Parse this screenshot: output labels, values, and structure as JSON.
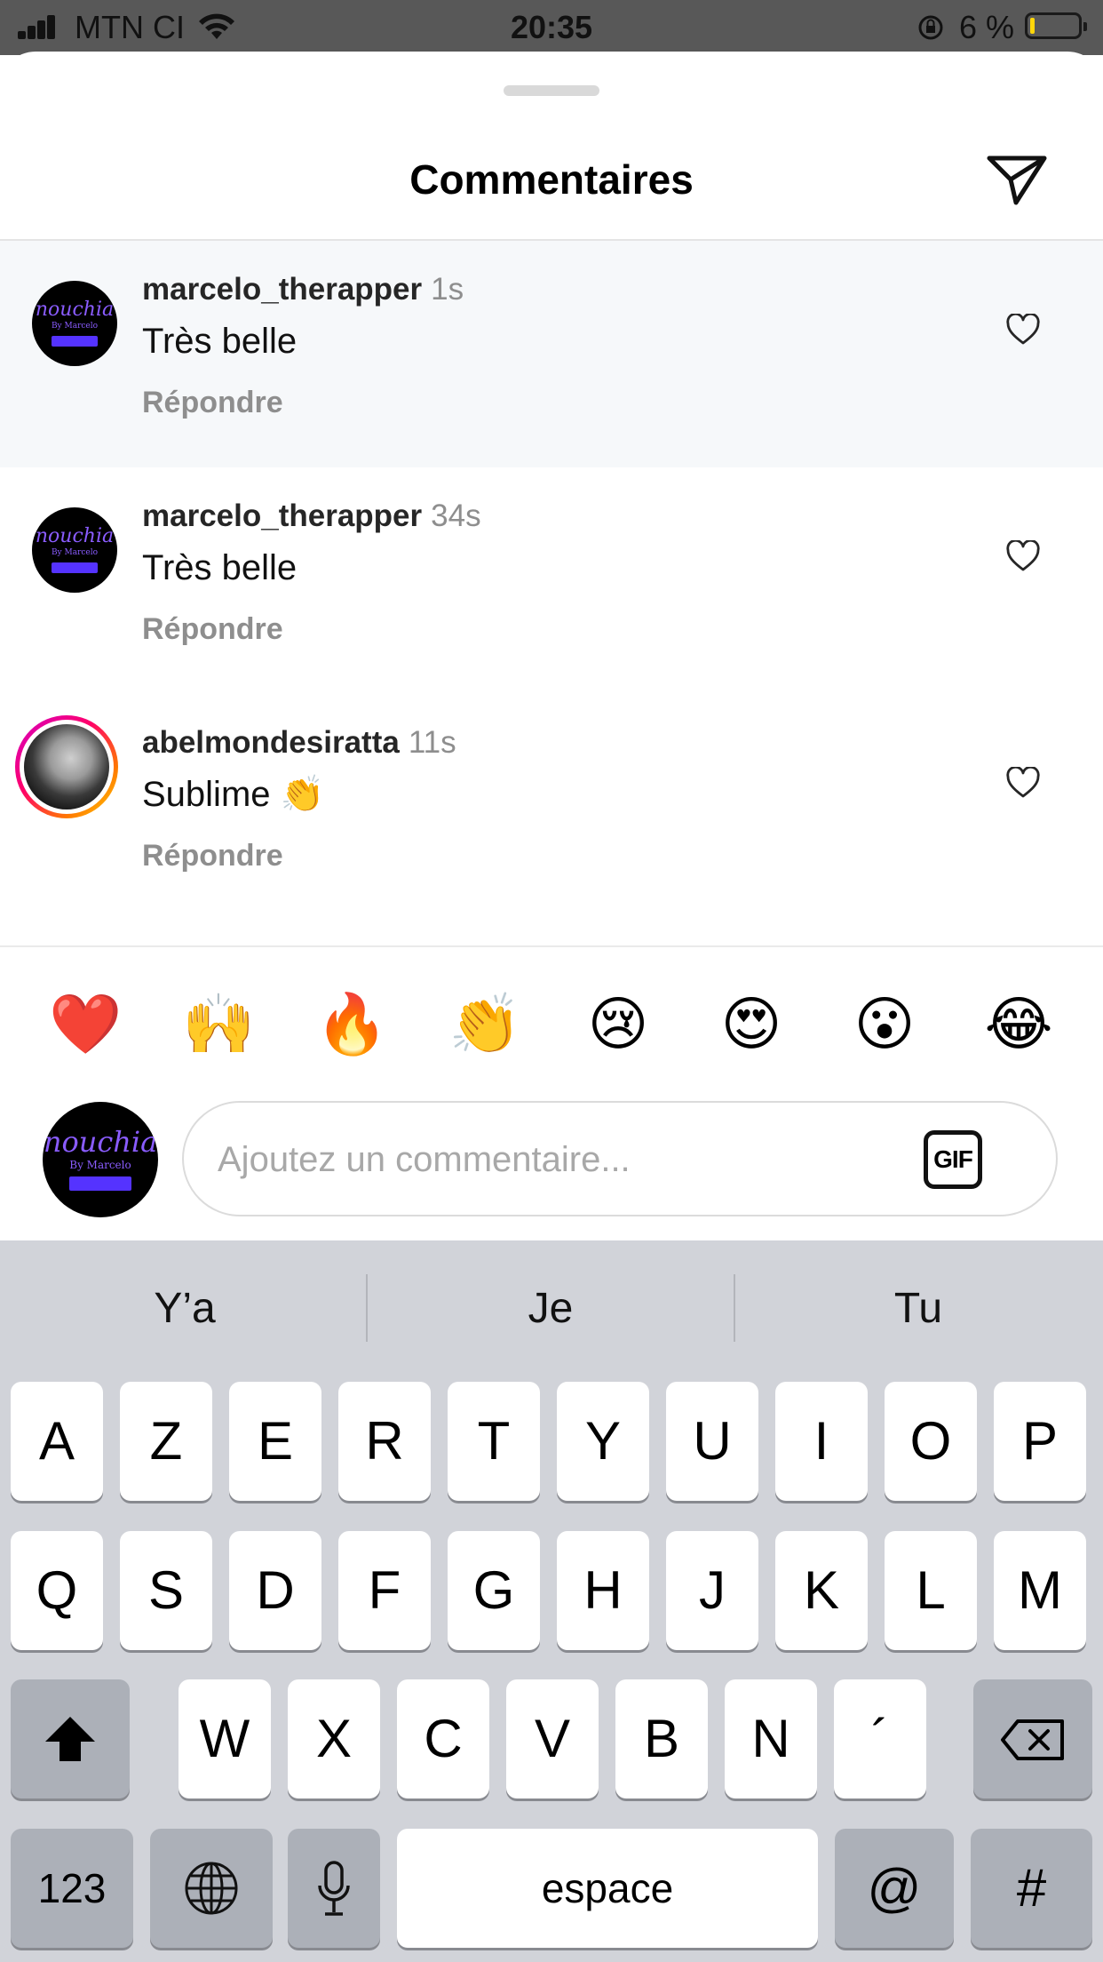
{
  "status_bar": {
    "carrier": "MTN CI",
    "time": "20:35",
    "battery": "6 %"
  },
  "sheet": {
    "title": "Commentaires"
  },
  "comments": [
    {
      "username": "marcelo_therapper",
      "time": "1s",
      "text": "Très belle",
      "reply": "Répondre",
      "avatar_logo": "nouchia",
      "avatar_sub": "By Marcelo"
    },
    {
      "username": "marcelo_therapper",
      "time": "34s",
      "text": "Très belle",
      "reply": "Répondre",
      "avatar_logo": "nouchia",
      "avatar_sub": "By Marcelo"
    },
    {
      "username": "abelmondesiratta",
      "time": "11s",
      "text": "Sublime 👏",
      "reply": "Répondre"
    }
  ],
  "emoji_bar": [
    "❤️",
    "🙌",
    "🔥",
    "👏",
    "😢",
    "😍",
    "😮",
    "😂"
  ],
  "composer": {
    "placeholder": "Ajoutez un commentaire...",
    "gif_label": "GIF",
    "avatar_logo": "nouchia",
    "avatar_sub": "By Marcelo"
  },
  "keyboard": {
    "suggestions": [
      "Y’a",
      "Je",
      "Tu"
    ],
    "row1": [
      "A",
      "Z",
      "E",
      "R",
      "T",
      "Y",
      "U",
      "I",
      "O",
      "P"
    ],
    "row2": [
      "Q",
      "S",
      "D",
      "F",
      "G",
      "H",
      "J",
      "K",
      "L",
      "M"
    ],
    "row3": [
      "W",
      "X",
      "C",
      "V",
      "B",
      "N",
      "´"
    ],
    "numbers_key": "123",
    "space_key": "espace",
    "at_key": "@",
    "hash_key": "#"
  }
}
